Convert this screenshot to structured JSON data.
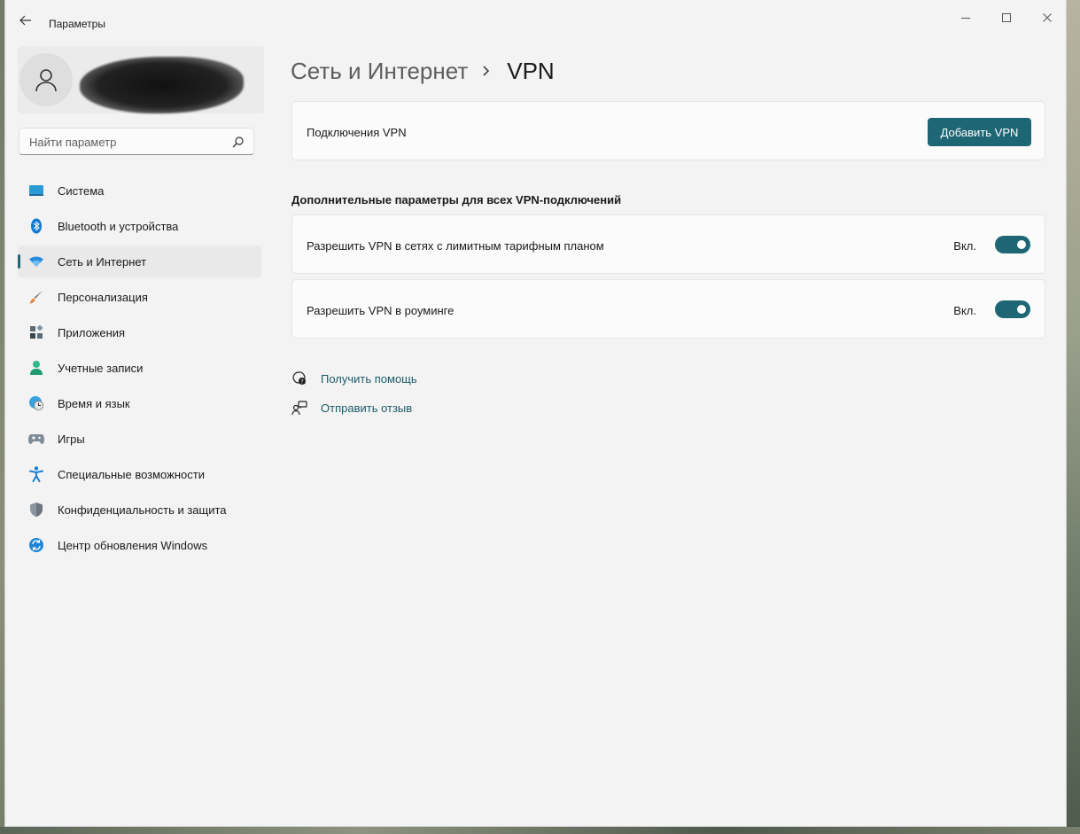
{
  "window": {
    "app_title": "Параметры"
  },
  "sidebar": {
    "search_placeholder": "Найти параметр",
    "items": [
      {
        "label": "Система",
        "icon": "monitor-icon"
      },
      {
        "label": "Bluetooth и устройства",
        "icon": "bluetooth-icon"
      },
      {
        "label": "Сеть и Интернет",
        "icon": "wifi-icon",
        "selected": true
      },
      {
        "label": "Персонализация",
        "icon": "brush-icon"
      },
      {
        "label": "Приложения",
        "icon": "apps-icon"
      },
      {
        "label": "Учетные записи",
        "icon": "person-icon"
      },
      {
        "label": "Время и язык",
        "icon": "globe-clock-icon"
      },
      {
        "label": "Игры",
        "icon": "gamepad-icon"
      },
      {
        "label": "Специальные возможности",
        "icon": "accessibility-icon"
      },
      {
        "label": "Конфиденциальность и защита",
        "icon": "shield-icon"
      },
      {
        "label": "Центр обновления Windows",
        "icon": "update-icon"
      }
    ]
  },
  "header": {
    "breadcrumb_parent": "Сеть и Интернет",
    "breadcrumb_current": "VPN"
  },
  "vpn_connections": {
    "label": "Подключения VPN",
    "add_button": "Добавить VPN"
  },
  "advanced": {
    "title": "Дополнительные параметры для всех VPN-подключений",
    "options": [
      {
        "label": "Разрешить VPN в сетях с лимитным тарифным планом",
        "state": "Вкл.",
        "on": true
      },
      {
        "label": "Разрешить VPN в роуминге",
        "state": "Вкл.",
        "on": true
      }
    ]
  },
  "links": {
    "help": "Получить помощь",
    "feedback": "Отправить отзыв"
  },
  "colors": {
    "accent": "#1f6675",
    "link": "#1b5b69",
    "background": "#f3f3f3",
    "card": "#fbfbfb"
  }
}
